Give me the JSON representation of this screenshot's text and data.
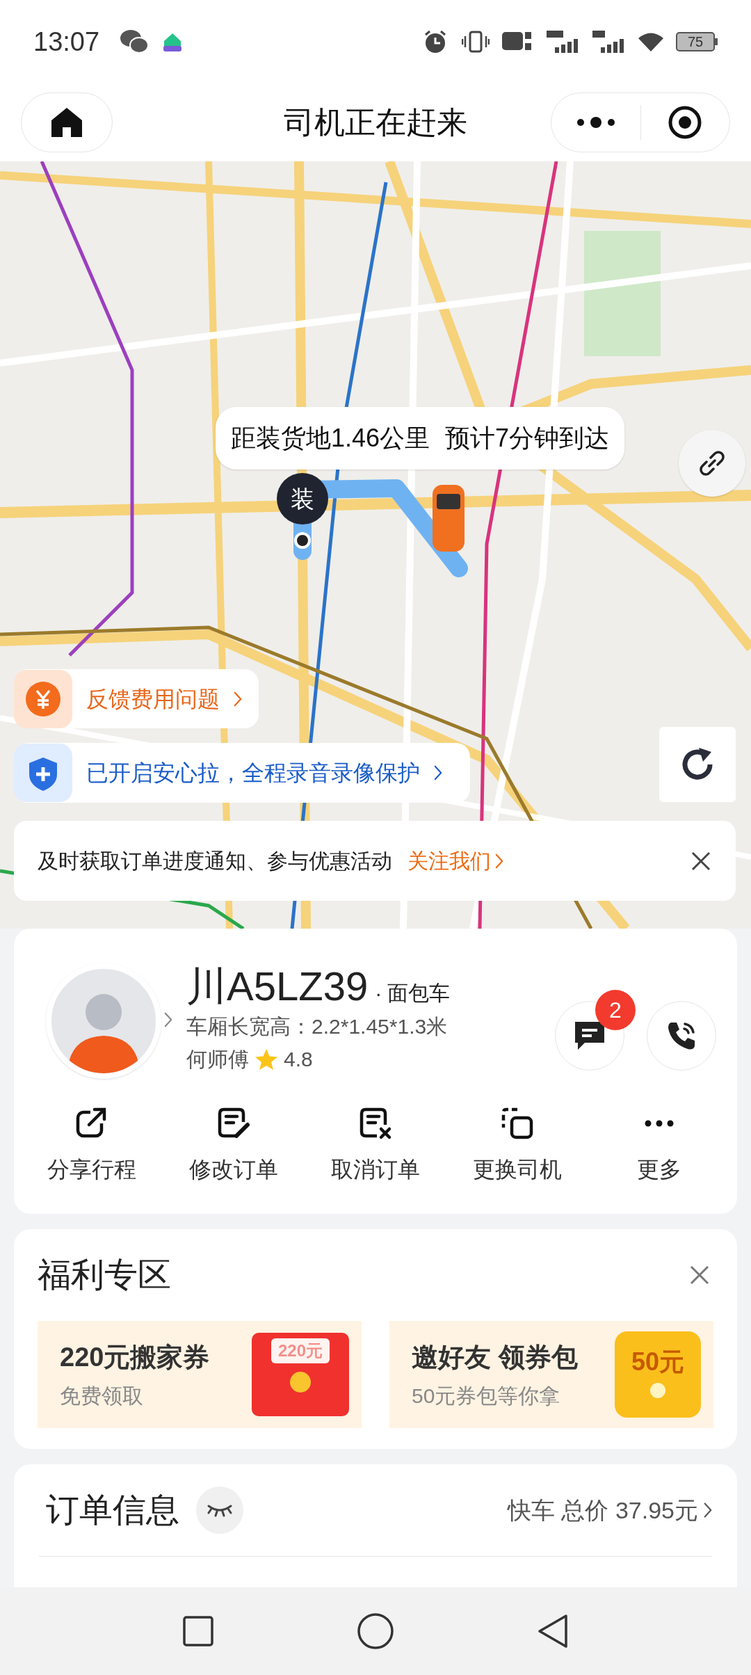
{
  "status_bar": {
    "time": "13:07",
    "battery": "75"
  },
  "header": {
    "title": "司机正在赶来"
  },
  "map": {
    "route_info": {
      "distance": "距装货地1.46公里",
      "eta": "预计7分钟到达"
    },
    "pickup_marker": "装"
  },
  "feedback_chip": {
    "text": "反馈费用问题"
  },
  "safety_chip": {
    "text": "已开启安心拉，全程录音录像保护"
  },
  "notice": {
    "text": "及时获取订单进度通知、参与优惠活动",
    "link": "关注我们"
  },
  "driver": {
    "plate": "川A5LZ39",
    "vehicle_type": "· 面包车",
    "dimensions": "车厢长宽高：2.2*1.45*1.3米",
    "name": "何师傅",
    "rating": "4.8",
    "message_badge": "2"
  },
  "actions": [
    {
      "kind": "share",
      "label": "分享行程"
    },
    {
      "kind": "edit",
      "label": "修改订单"
    },
    {
      "kind": "cancel",
      "label": "取消订单"
    },
    {
      "kind": "swap",
      "label": "更换司机"
    },
    {
      "kind": "more",
      "label": "更多"
    }
  ],
  "benefits": {
    "title": "福利专区",
    "cards": [
      {
        "kind": "coupon",
        "title": "220元搬家券",
        "subtitle": "免费领取",
        "badge": "220元"
      },
      {
        "kind": "invite",
        "title": "邀好友 领券包",
        "subtitle": "50元券包等你拿",
        "badge": "50元"
      }
    ]
  },
  "order": {
    "title": "订单信息",
    "summary": "快车 总价 37.95元"
  }
}
